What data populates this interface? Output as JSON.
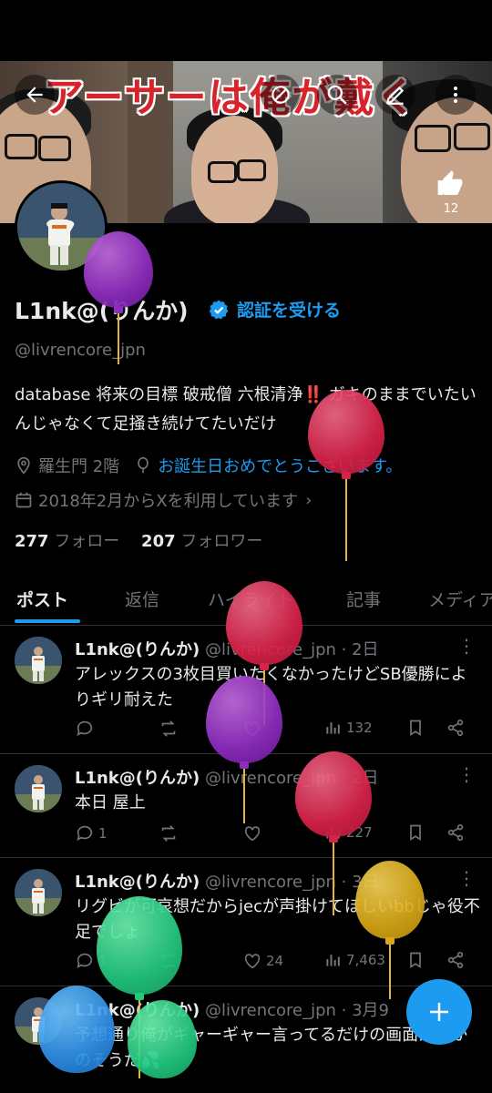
{
  "header": {
    "banner_title": "アーサーは俺が戴く",
    "like_count": "12"
  },
  "profile": {
    "display_name": "L1nk@(りんか)",
    "verify_label": "認証を受ける",
    "handle": "@livrencore_jpn",
    "bio": "database 将来の目標 破戒僧 六根清浄‼️ ガキのままでいたいんじゃなくて足掻き続けてたいだけ",
    "location": "羅生門 2階",
    "birthday": "お誕生日おめでとうございます。",
    "joined": "2018年2月からXを利用しています",
    "following_count": "277",
    "following_label": "フォロー",
    "followers_count": "207",
    "followers_label": "フォロワー"
  },
  "tabs": [
    "ポスト",
    "返信",
    "ハイライト",
    "記事",
    "メディア"
  ],
  "posts": [
    {
      "name": "L1nk@(りんか)",
      "meta": "@livrencore_jpn · 2日",
      "text": "アレックスの3枚目買いたくなかったけどSB優勝によりギリ耐えた",
      "replies": "",
      "retweets": "",
      "likes": "",
      "views": "132"
    },
    {
      "name": "L1nk@(りんか)",
      "meta": "@livrencore_jpn · 2日",
      "text": "本日 屋上",
      "replies": "1",
      "retweets": "",
      "likes": "",
      "views": "227"
    },
    {
      "name": "L1nk@(りんか)",
      "meta": "@livrencore_jpn · 3日",
      "text": "リグビが可哀想だからjecが声掛けてほしいbbじゃ役不足でしょ",
      "replies": "1",
      "retweets": "",
      "likes": "24",
      "views": "7,463"
    },
    {
      "name": "L1nk@(りんか)",
      "meta": "@livrencore_jpn · 3月9",
      "text": "予想通り俺がギャーギャー言ってるだけの画面だあかのそうだ💦",
      "replies": "",
      "retweets": "",
      "likes": "",
      "views": ""
    }
  ],
  "icons": {
    "back": "back-arrow-icon",
    "mute": "mute-icon",
    "search": "search-icon",
    "edit": "edit-icon",
    "more": "more-vertical-icon",
    "like_banner": "thumbs-up-icon",
    "verified": "verified-badge-icon",
    "location": "location-icon",
    "birthday": "balloon-icon",
    "calendar": "calendar-icon",
    "compose": "plus-icon"
  },
  "colors": {
    "accent": "#1d9bf0",
    "background": "#000000",
    "muted": "#71767b",
    "title_red": "#d9232a"
  }
}
